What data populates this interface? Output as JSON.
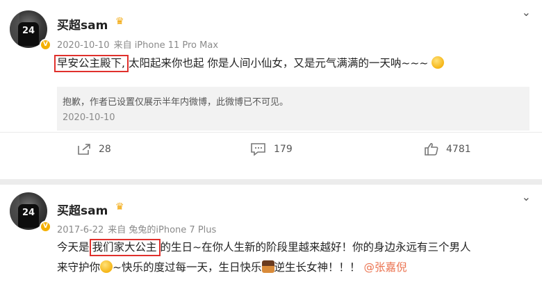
{
  "post1": {
    "username": "买超sam",
    "meta_date": "2020-10-10",
    "meta_source": "来自 iPhone 11 Pro Max",
    "text_highlight": "早安公主殿下,",
    "text_rest": "太阳起来你也起 你是人间小仙女，又是元气满满的一天呐~~~",
    "hidden_notice": "抱歉，作者已设置仅展示半年内微博，此微博已不可见。",
    "hidden_date": "2020-10-10",
    "repost_count": "28",
    "comment_count": "179",
    "like_count": "4781"
  },
  "post2": {
    "username": "买超sam",
    "meta_date": "2017-6-22",
    "meta_source": "来自 兔兔的iPhone 7 Plus",
    "line1_pre": "今天是",
    "line1_highlight": "我们家大公主",
    "line1_post": "的生日~在你人生新的阶段里越来越好！你的身边永远有三个男人",
    "line2_a": "来守护你",
    "line2_b": "~快乐的度过每一天，生日快乐",
    "line2_c": "逆生长女神！！！",
    "mention": "@张嘉倪"
  },
  "avatar_number": "24",
  "icons": {
    "verified": "verified-badge-icon",
    "crown": "crown-icon",
    "more": "chevron-down-icon",
    "repost": "repost-icon",
    "comment": "comment-icon",
    "like": "thumbs-up-icon"
  },
  "colors": {
    "highlight_box": "#e0302c",
    "mention": "#eb7350",
    "verified": "#f4b000"
  }
}
